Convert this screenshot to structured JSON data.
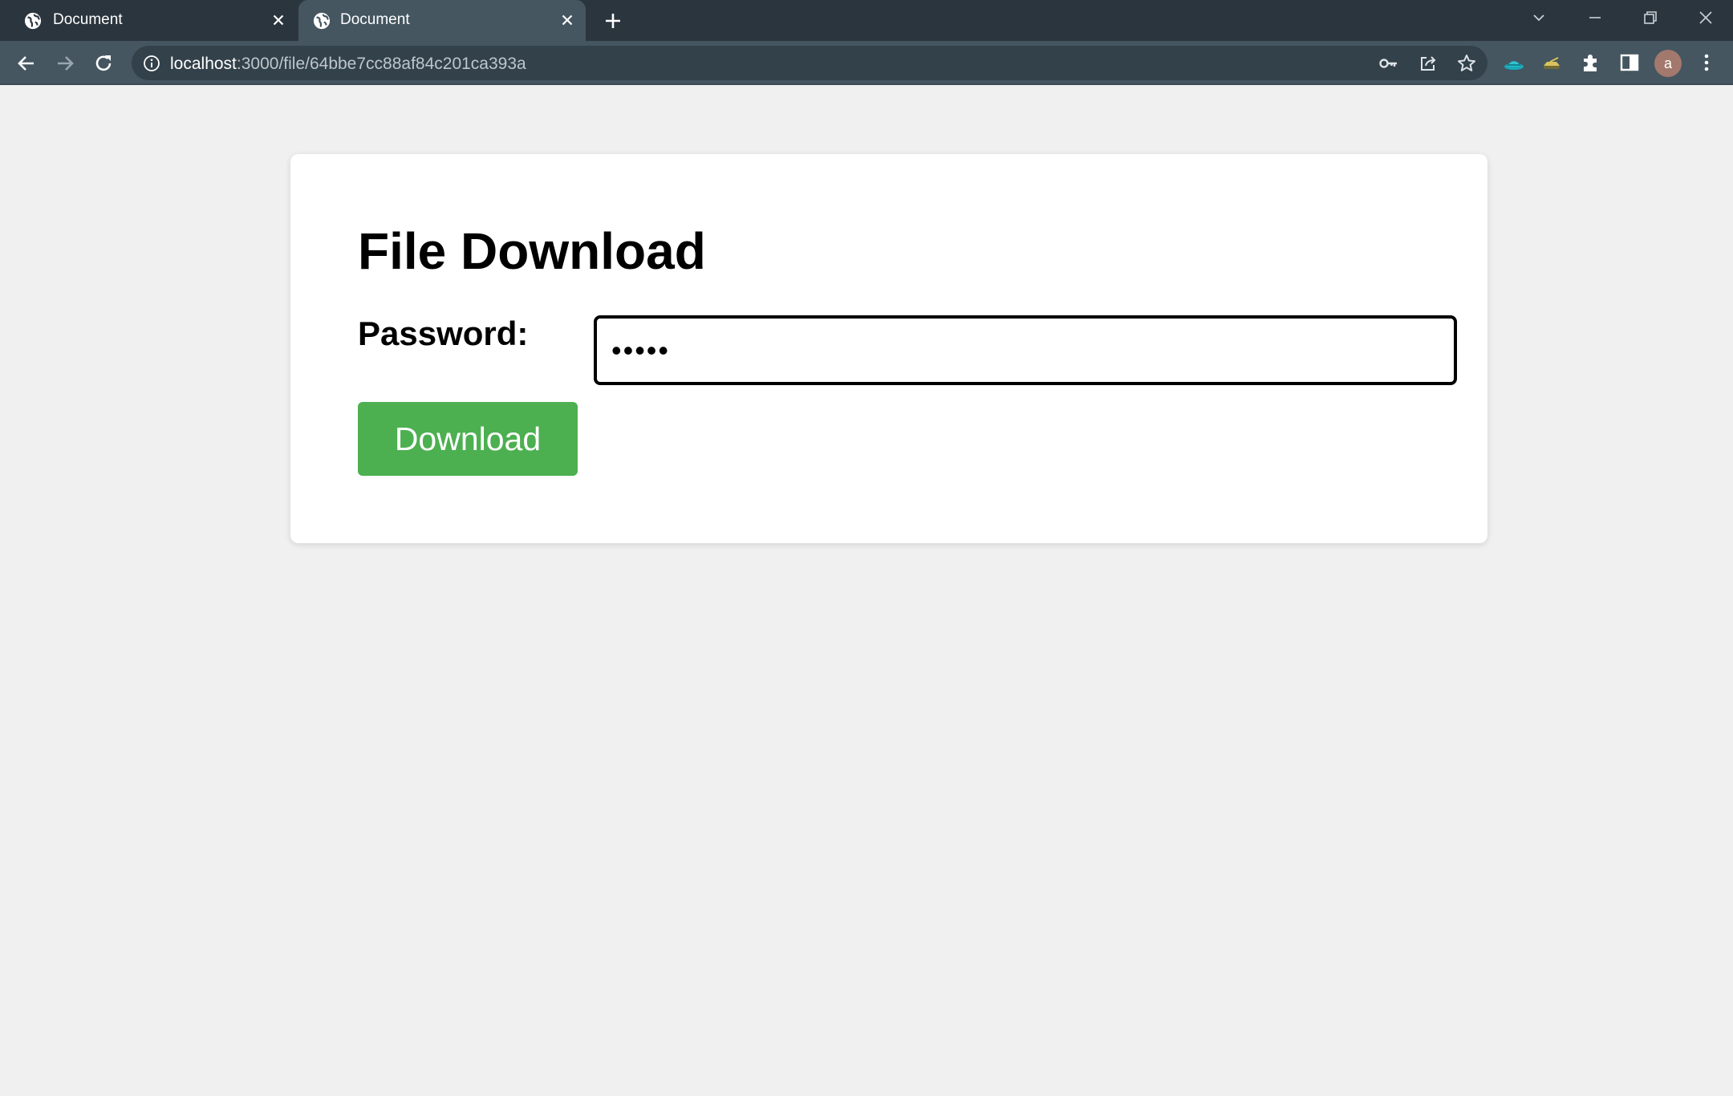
{
  "browser": {
    "tabs": [
      {
        "title": "Document",
        "active": false,
        "favicon": "globe-icon"
      },
      {
        "title": "Document",
        "active": true,
        "favicon": "globe-icon"
      }
    ],
    "url": {
      "host": "localhost",
      "path": ":3000/file/64bbe7cc88af84c201ca393a"
    },
    "avatar_letter": "a"
  },
  "page": {
    "title": "File Download",
    "password_label": "Password:",
    "password_value": "•••••",
    "download_label": "Download"
  },
  "colors": {
    "tabstrip": "#2b353d",
    "toolbar": "#455661",
    "page_background": "#f0f0f0",
    "button": "#4caf50"
  }
}
